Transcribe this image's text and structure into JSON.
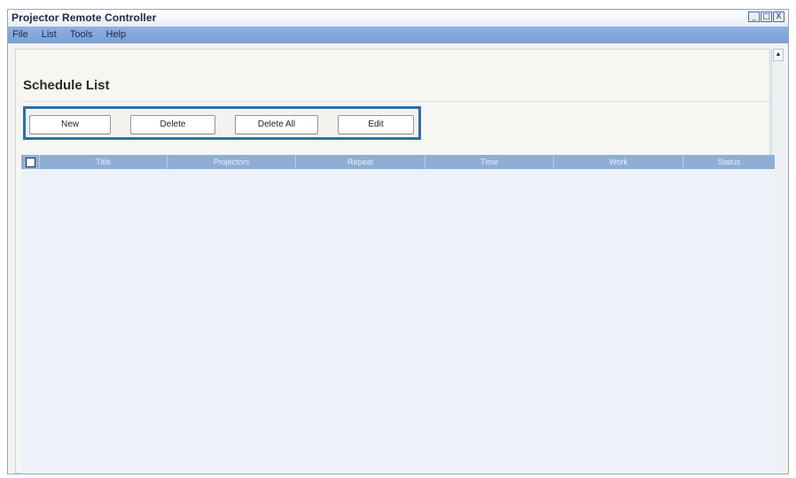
{
  "window": {
    "title": "Projector Remote Controller",
    "controls": {
      "minimize": "_",
      "maximize": "□",
      "close": "X"
    }
  },
  "menu": {
    "items": [
      {
        "label": "File"
      },
      {
        "label": "List"
      },
      {
        "label": "Tools"
      },
      {
        "label": "Help"
      }
    ]
  },
  "page": {
    "heading": "Schedule List"
  },
  "toolbar": {
    "new_label": "New",
    "delete_label": "Delete",
    "delete_all_label": "Delete All",
    "edit_label": "Edit"
  },
  "table": {
    "columns": [
      "Title",
      "Projectors",
      "Repeat",
      "Time",
      "Work",
      "Status"
    ],
    "rows": []
  },
  "colors": {
    "accent_frame": "#2f6ea8",
    "header_bg": "#8eaed8",
    "menubar_bg": "#7aa0d8",
    "body_bg": "#edf2f9"
  },
  "icons": [
    "scroll-up-arrow-icon"
  ]
}
